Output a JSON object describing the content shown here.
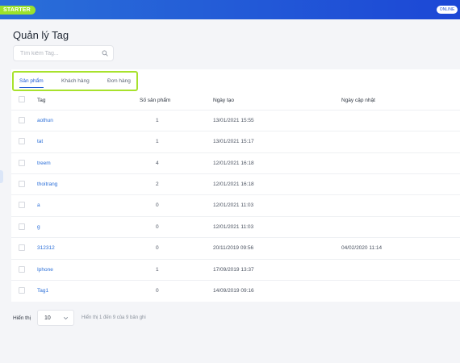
{
  "header": {
    "plan_badge": "STARTER",
    "status_badge": "ONLINE"
  },
  "page": {
    "title": "Quản lý Tag"
  },
  "search": {
    "placeholder": "Tìm kiếm Tag..."
  },
  "tabs": [
    {
      "label": "Sản phẩm",
      "active": true
    },
    {
      "label": "Khách hàng",
      "active": false
    },
    {
      "label": "Đơn hàng",
      "active": false
    }
  ],
  "table": {
    "columns": {
      "tag": "Tag",
      "count": "Số sản phẩm",
      "created": "Ngày tạo",
      "updated": "Ngày cập nhật"
    },
    "rows": [
      {
        "tag": "aothun",
        "count": "1",
        "created": "13/01/2021 15:55",
        "updated": ""
      },
      {
        "tag": "tat",
        "count": "1",
        "created": "13/01/2021 15:17",
        "updated": ""
      },
      {
        "tag": "treem",
        "count": "4",
        "created": "12/01/2021 16:18",
        "updated": ""
      },
      {
        "tag": "thoitrang",
        "count": "2",
        "created": "12/01/2021 16:18",
        "updated": ""
      },
      {
        "tag": "a",
        "count": "0",
        "created": "12/01/2021 11:03",
        "updated": ""
      },
      {
        "tag": "g",
        "count": "0",
        "created": "12/01/2021 11:03",
        "updated": ""
      },
      {
        "tag": "312312",
        "count": "0",
        "created": "20/11/2019 09:56",
        "updated": "04/02/2020 11:14"
      },
      {
        "tag": "Iphone",
        "count": "1",
        "created": "17/09/2019 13:37",
        "updated": ""
      },
      {
        "tag": "Tag1",
        "count": "0",
        "created": "14/09/2019 09:16",
        "updated": ""
      }
    ]
  },
  "footer": {
    "show_label": "Hiển thị",
    "page_size": "10",
    "info": "Hiển thị 1 đến 9 của 9 bản ghi"
  },
  "colors": {
    "accent": "#1e5ad6",
    "brand_green": "#9be22b",
    "link": "#2a6ed8"
  }
}
